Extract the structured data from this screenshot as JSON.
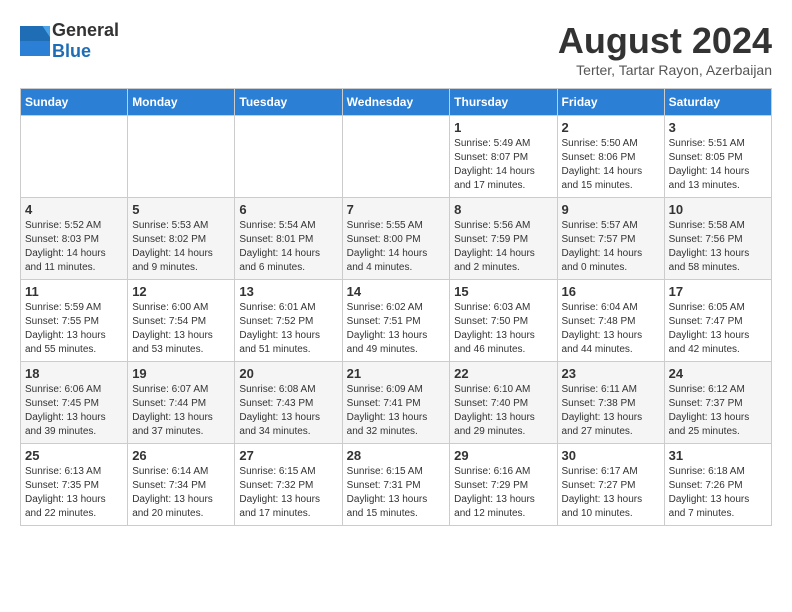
{
  "header": {
    "logo_general": "General",
    "logo_blue": "Blue",
    "month_year": "August 2024",
    "location": "Terter, Tartar Rayon, Azerbaijan"
  },
  "weekdays": [
    "Sunday",
    "Monday",
    "Tuesday",
    "Wednesday",
    "Thursday",
    "Friday",
    "Saturday"
  ],
  "weeks": [
    [
      {
        "day": "",
        "info": ""
      },
      {
        "day": "",
        "info": ""
      },
      {
        "day": "",
        "info": ""
      },
      {
        "day": "",
        "info": ""
      },
      {
        "day": "1",
        "info": "Sunrise: 5:49 AM\nSunset: 8:07 PM\nDaylight: 14 hours and 17 minutes."
      },
      {
        "day": "2",
        "info": "Sunrise: 5:50 AM\nSunset: 8:06 PM\nDaylight: 14 hours and 15 minutes."
      },
      {
        "day": "3",
        "info": "Sunrise: 5:51 AM\nSunset: 8:05 PM\nDaylight: 14 hours and 13 minutes."
      }
    ],
    [
      {
        "day": "4",
        "info": "Sunrise: 5:52 AM\nSunset: 8:03 PM\nDaylight: 14 hours and 11 minutes."
      },
      {
        "day": "5",
        "info": "Sunrise: 5:53 AM\nSunset: 8:02 PM\nDaylight: 14 hours and 9 minutes."
      },
      {
        "day": "6",
        "info": "Sunrise: 5:54 AM\nSunset: 8:01 PM\nDaylight: 14 hours and 6 minutes."
      },
      {
        "day": "7",
        "info": "Sunrise: 5:55 AM\nSunset: 8:00 PM\nDaylight: 14 hours and 4 minutes."
      },
      {
        "day": "8",
        "info": "Sunrise: 5:56 AM\nSunset: 7:59 PM\nDaylight: 14 hours and 2 minutes."
      },
      {
        "day": "9",
        "info": "Sunrise: 5:57 AM\nSunset: 7:57 PM\nDaylight: 14 hours and 0 minutes."
      },
      {
        "day": "10",
        "info": "Sunrise: 5:58 AM\nSunset: 7:56 PM\nDaylight: 13 hours and 58 minutes."
      }
    ],
    [
      {
        "day": "11",
        "info": "Sunrise: 5:59 AM\nSunset: 7:55 PM\nDaylight: 13 hours and 55 minutes."
      },
      {
        "day": "12",
        "info": "Sunrise: 6:00 AM\nSunset: 7:54 PM\nDaylight: 13 hours and 53 minutes."
      },
      {
        "day": "13",
        "info": "Sunrise: 6:01 AM\nSunset: 7:52 PM\nDaylight: 13 hours and 51 minutes."
      },
      {
        "day": "14",
        "info": "Sunrise: 6:02 AM\nSunset: 7:51 PM\nDaylight: 13 hours and 49 minutes."
      },
      {
        "day": "15",
        "info": "Sunrise: 6:03 AM\nSunset: 7:50 PM\nDaylight: 13 hours and 46 minutes."
      },
      {
        "day": "16",
        "info": "Sunrise: 6:04 AM\nSunset: 7:48 PM\nDaylight: 13 hours and 44 minutes."
      },
      {
        "day": "17",
        "info": "Sunrise: 6:05 AM\nSunset: 7:47 PM\nDaylight: 13 hours and 42 minutes."
      }
    ],
    [
      {
        "day": "18",
        "info": "Sunrise: 6:06 AM\nSunset: 7:45 PM\nDaylight: 13 hours and 39 minutes."
      },
      {
        "day": "19",
        "info": "Sunrise: 6:07 AM\nSunset: 7:44 PM\nDaylight: 13 hours and 37 minutes."
      },
      {
        "day": "20",
        "info": "Sunrise: 6:08 AM\nSunset: 7:43 PM\nDaylight: 13 hours and 34 minutes."
      },
      {
        "day": "21",
        "info": "Sunrise: 6:09 AM\nSunset: 7:41 PM\nDaylight: 13 hours and 32 minutes."
      },
      {
        "day": "22",
        "info": "Sunrise: 6:10 AM\nSunset: 7:40 PM\nDaylight: 13 hours and 29 minutes."
      },
      {
        "day": "23",
        "info": "Sunrise: 6:11 AM\nSunset: 7:38 PM\nDaylight: 13 hours and 27 minutes."
      },
      {
        "day": "24",
        "info": "Sunrise: 6:12 AM\nSunset: 7:37 PM\nDaylight: 13 hours and 25 minutes."
      }
    ],
    [
      {
        "day": "25",
        "info": "Sunrise: 6:13 AM\nSunset: 7:35 PM\nDaylight: 13 hours and 22 minutes."
      },
      {
        "day": "26",
        "info": "Sunrise: 6:14 AM\nSunset: 7:34 PM\nDaylight: 13 hours and 20 minutes."
      },
      {
        "day": "27",
        "info": "Sunrise: 6:15 AM\nSunset: 7:32 PM\nDaylight: 13 hours and 17 minutes."
      },
      {
        "day": "28",
        "info": "Sunrise: 6:15 AM\nSunset: 7:31 PM\nDaylight: 13 hours and 15 minutes."
      },
      {
        "day": "29",
        "info": "Sunrise: 6:16 AM\nSunset: 7:29 PM\nDaylight: 13 hours and 12 minutes."
      },
      {
        "day": "30",
        "info": "Sunrise: 6:17 AM\nSunset: 7:27 PM\nDaylight: 13 hours and 10 minutes."
      },
      {
        "day": "31",
        "info": "Sunrise: 6:18 AM\nSunset: 7:26 PM\nDaylight: 13 hours and 7 minutes."
      }
    ]
  ]
}
